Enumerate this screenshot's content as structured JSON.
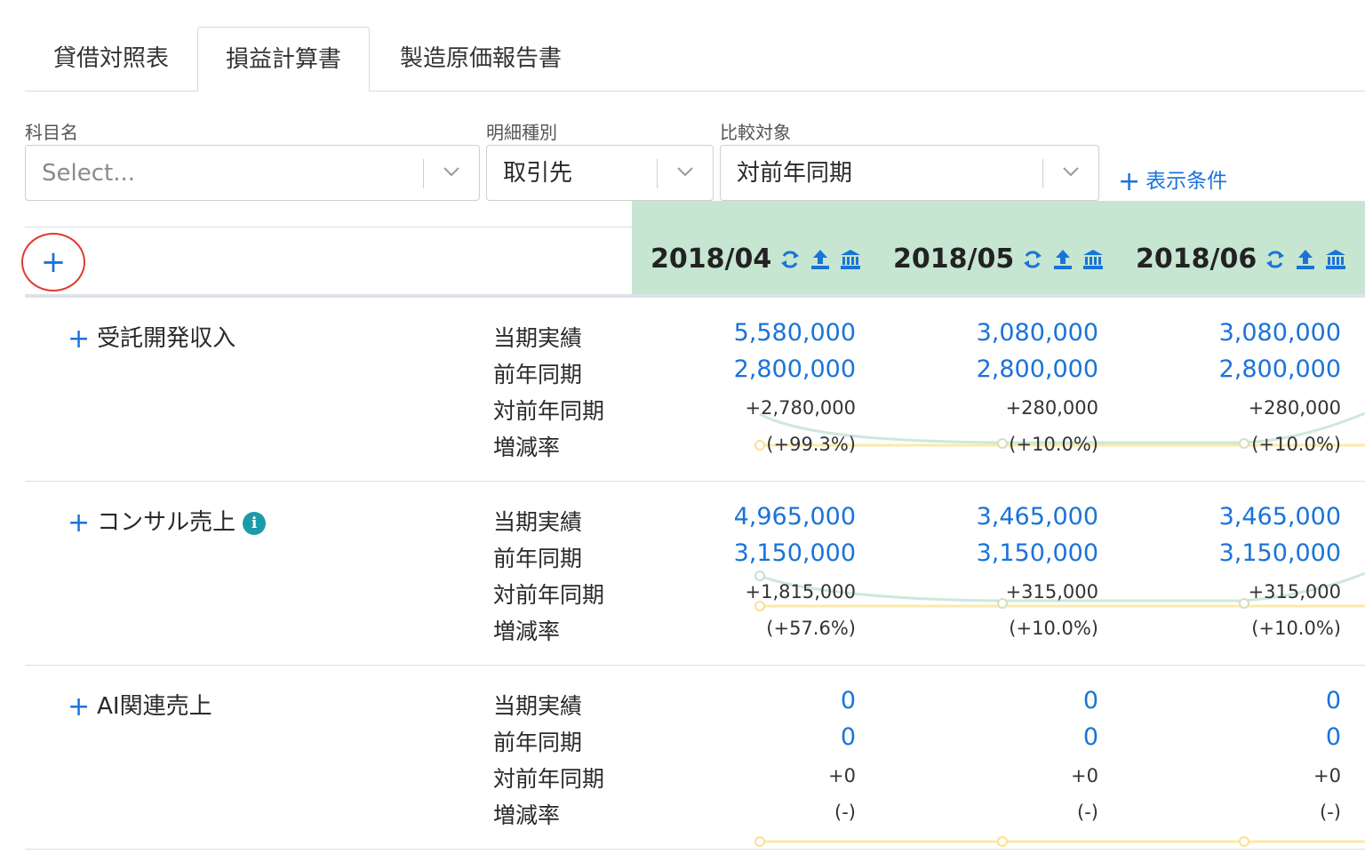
{
  "tabs": [
    {
      "label": "貸借対照表"
    },
    {
      "label": "損益計算書",
      "active": true
    },
    {
      "label": "製造原価報告書"
    }
  ],
  "filters": {
    "account": {
      "label": "科目名",
      "placeholder": "Select..."
    },
    "detail_type": {
      "label": "明細種別",
      "value": "取引先"
    },
    "comparison": {
      "label": "比較対象",
      "value": "対前年同期"
    },
    "conditions_button": "表示条件"
  },
  "add_button": "+",
  "months": [
    {
      "label": "2018/04"
    },
    {
      "label": "2018/05"
    },
    {
      "label": "2018/06"
    }
  ],
  "metric_labels": [
    "当期実績",
    "前年同期",
    "対前年同期",
    "増減率"
  ],
  "accounts": [
    {
      "name": "受託開発収入",
      "has_info": false,
      "actual": [
        "5,580,000",
        "3,080,000",
        "3,080,000"
      ],
      "prior": [
        "2,800,000",
        "2,800,000",
        "2,800,000"
      ],
      "diff": [
        "+2,780,000",
        "+280,000",
        "+280,000"
      ],
      "rate": [
        "(+99.3%)",
        "(+10.0%)",
        "(+10.0%)"
      ]
    },
    {
      "name": "コンサル売上",
      "has_info": true,
      "actual": [
        "4,965,000",
        "3,465,000",
        "3,465,000"
      ],
      "prior": [
        "3,150,000",
        "3,150,000",
        "3,150,000"
      ],
      "diff": [
        "+1,815,000",
        "+315,000",
        "+315,000"
      ],
      "rate": [
        "(+57.6%)",
        "(+10.0%)",
        "(+10.0%)"
      ]
    },
    {
      "name": "AI関連売上",
      "has_info": false,
      "actual": [
        "0",
        "0",
        "0"
      ],
      "prior": [
        "0",
        "0",
        "0"
      ],
      "diff": [
        "+0",
        "+0",
        "+0"
      ],
      "rate": [
        "(-)",
        "(-)",
        "(-)"
      ]
    }
  ],
  "colors": {
    "accent": "#1a73d9",
    "header_bg": "#c6e6d1",
    "highlight_circle": "#e03a2e",
    "info_badge": "#1b9aaa",
    "spark_actual": "#cde8dc",
    "spark_prior": "#fbeaa8"
  },
  "icons": {
    "month_actions": [
      "refresh-icon",
      "upload-icon",
      "bank-icon"
    ],
    "select": "chevron-down-icon",
    "info": "info-icon"
  }
}
